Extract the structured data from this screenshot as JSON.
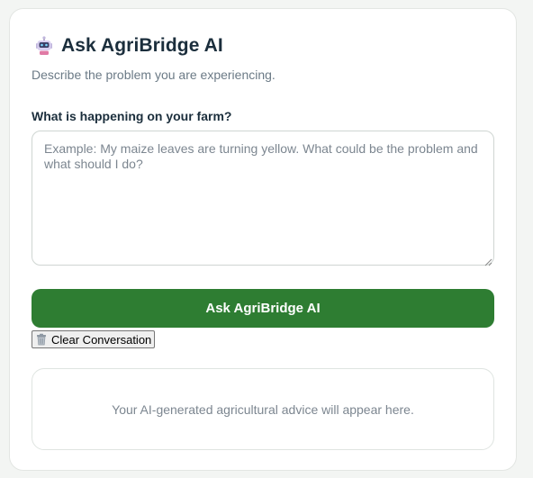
{
  "header": {
    "icon": "robot-icon",
    "title": "Ask AgriBridge AI",
    "subtitle": "Describe the problem you are experiencing."
  },
  "form": {
    "label": "What is happening on your farm?",
    "textarea_value": "",
    "textarea_placeholder": "Example: My maize leaves are turning yellow. What could be the problem and what should I do?"
  },
  "actions": {
    "ask_label": "Ask AgriBridge AI",
    "clear_icon": "trash-icon",
    "clear_label": "Clear Conversation"
  },
  "response": {
    "placeholder": "Your AI-generated agricultural advice will appear here."
  },
  "colors": {
    "accent": "#2e7d32",
    "title": "#1b2e3c",
    "muted": "#6b7a86"
  }
}
